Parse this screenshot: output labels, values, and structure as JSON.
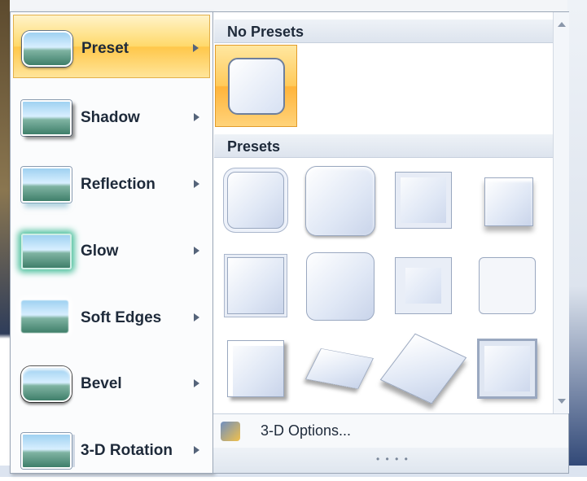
{
  "menu": {
    "items": [
      {
        "label": "Preset",
        "icon": "preset-effect-icon",
        "active": true
      },
      {
        "label": "Shadow",
        "icon": "shadow-effect-icon",
        "active": false
      },
      {
        "label": "Reflection",
        "icon": "reflection-effect-icon",
        "active": false
      },
      {
        "label": "Glow",
        "icon": "glow-effect-icon",
        "active": false
      },
      {
        "label": "Soft Edges",
        "icon": "soft-edges-effect-icon",
        "active": false
      },
      {
        "label": "Bevel",
        "icon": "bevel-effect-icon",
        "active": false
      },
      {
        "label": "3-D Rotation",
        "icon": "3d-rotation-effect-icon",
        "active": false
      }
    ]
  },
  "gallery": {
    "no_presets_header": "No Presets",
    "presets_header": "Presets",
    "options_label": "3-D Options...",
    "options_icon": "3d-options-icon",
    "grip": "• • • •"
  }
}
